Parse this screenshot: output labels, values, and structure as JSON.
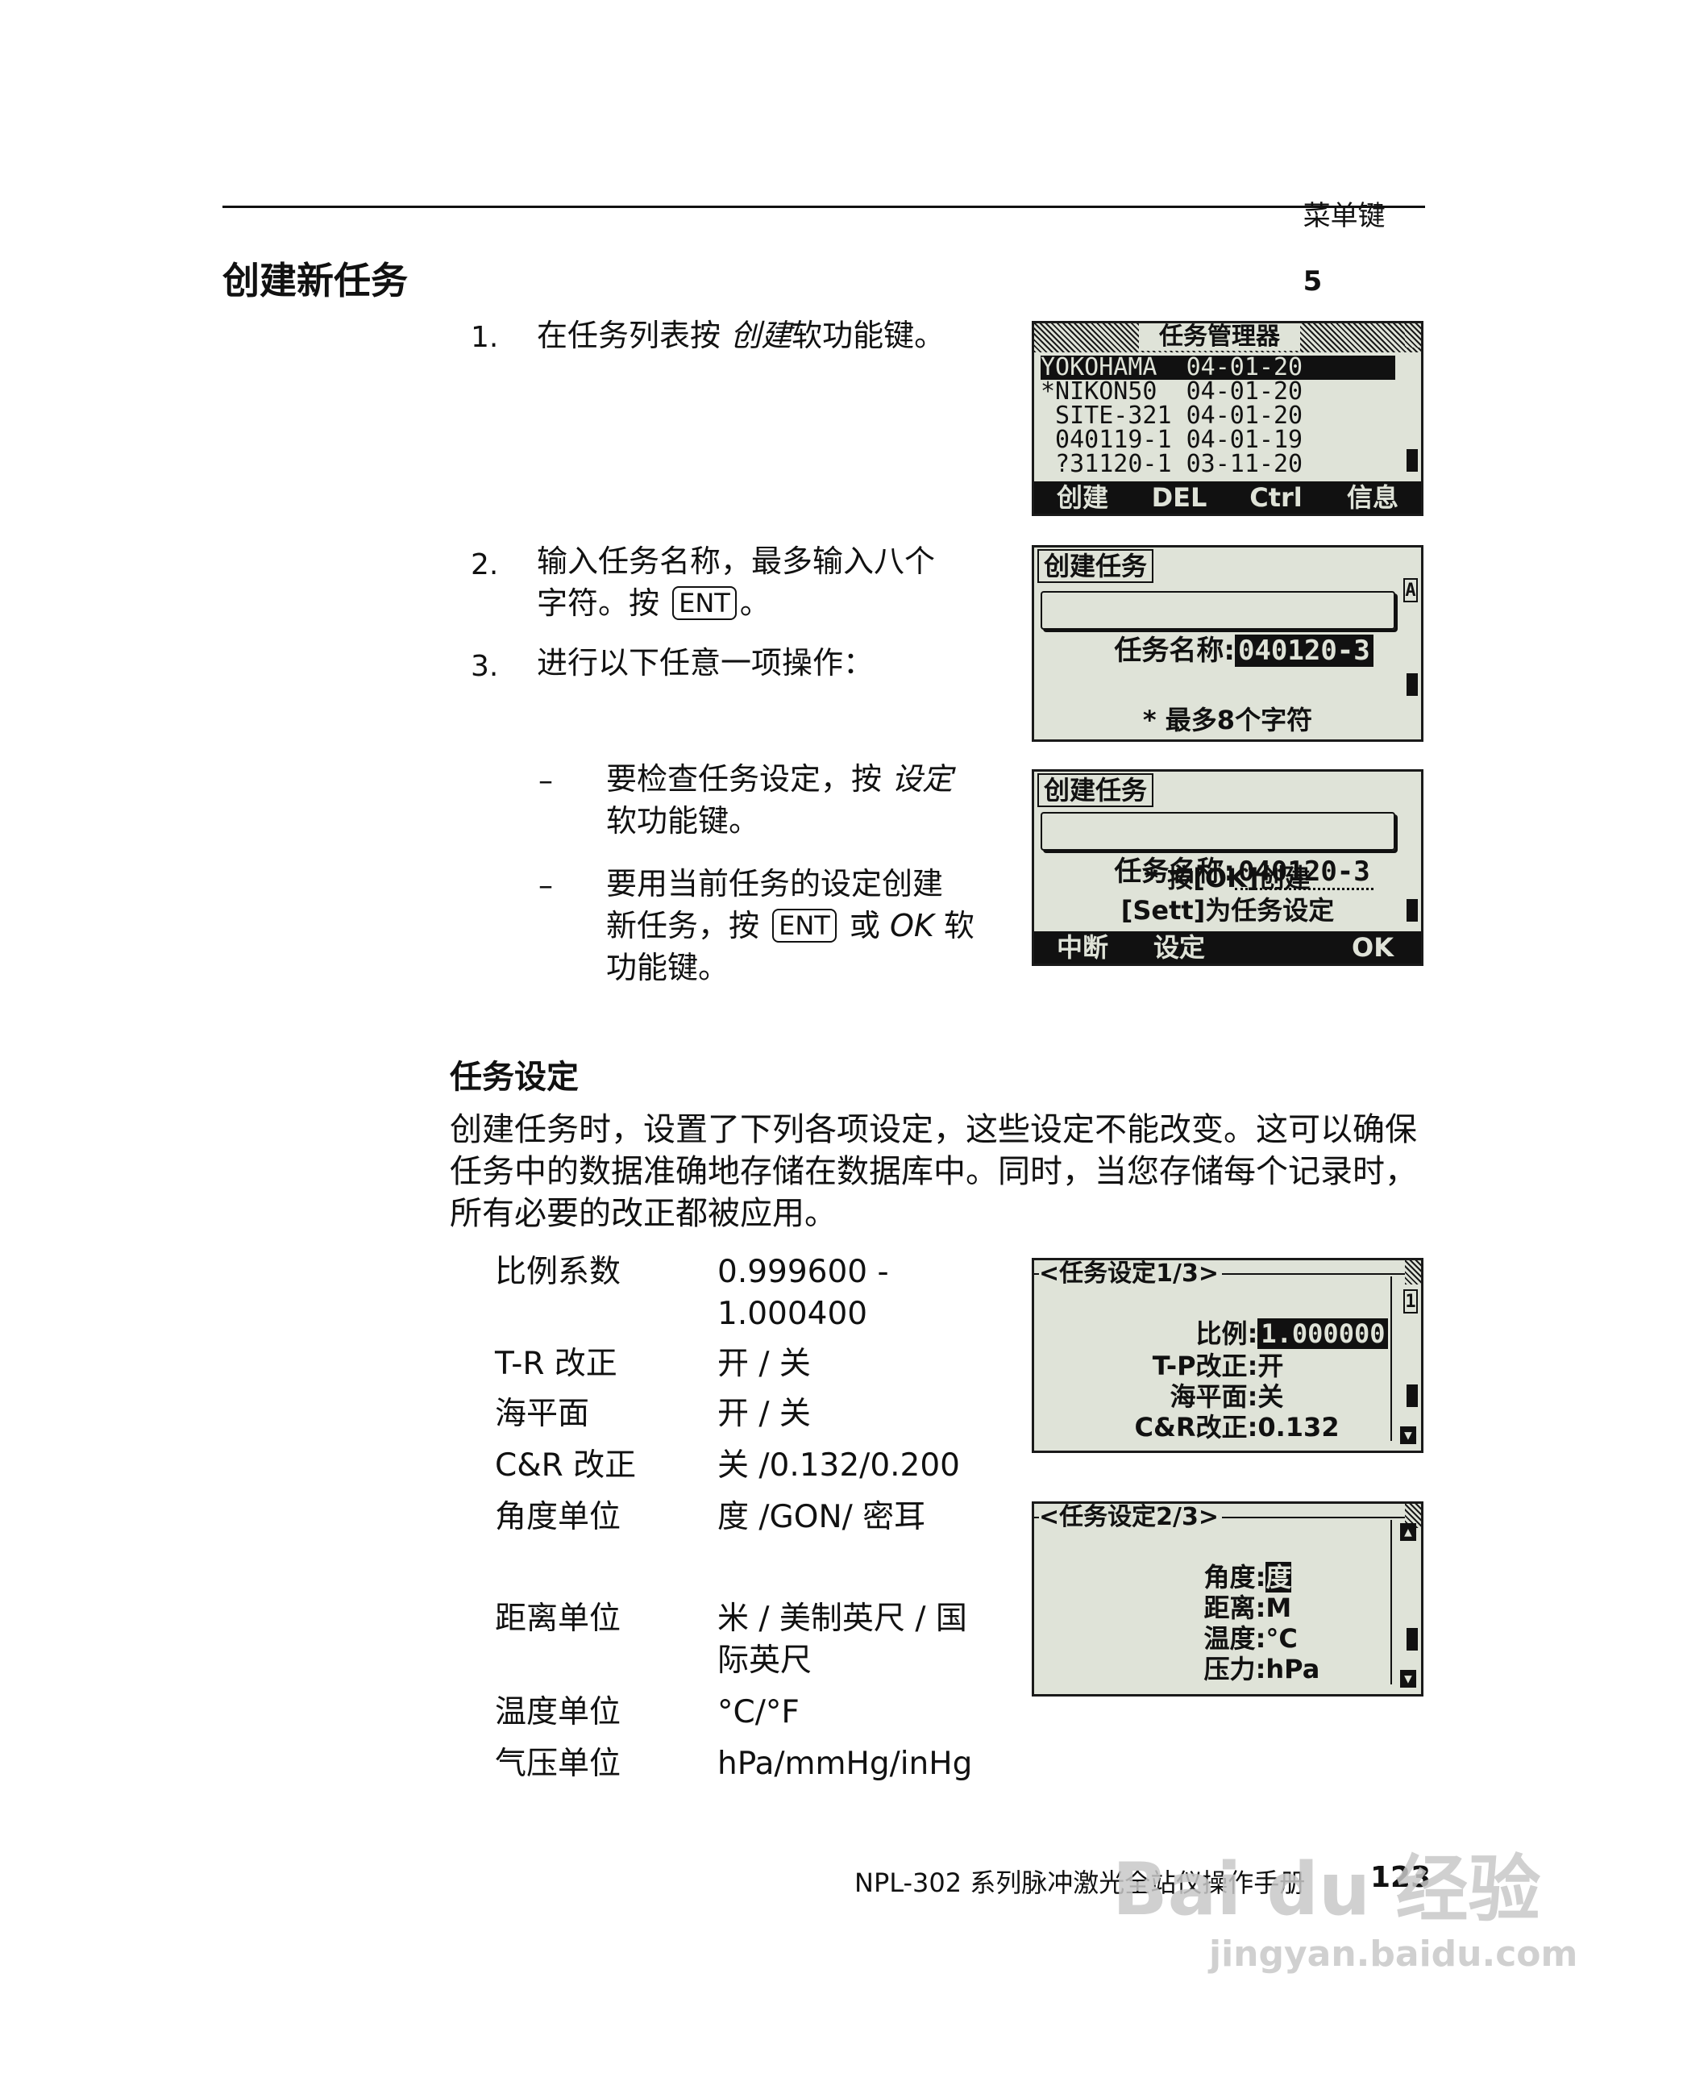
{
  "header": {
    "section_title": "菜单键",
    "chapter_number": "5"
  },
  "heading_main": "创建新任务",
  "steps": [
    {
      "num": "1.",
      "parts": [
        "在任务列表按 ",
        "创建",
        "软功能键。"
      ]
    },
    {
      "num": "2.",
      "line1": "输入任务名称，最多输入八个",
      "line2_pre": "字符。按 ",
      "key": "ENT",
      "line2_post": "。"
    },
    {
      "num": "3.",
      "text": "进行以下任意一项操作："
    }
  ],
  "sub_steps": [
    {
      "dash": "–",
      "line1_pre": "要检查任务设定，按 ",
      "line1_em": "设定",
      "line2": "软功能键。"
    },
    {
      "dash": "–",
      "line1": "要用当前任务的设定创建",
      "line2_pre": "新任务，按 ",
      "key": "ENT",
      "line2_mid": " 或 ",
      "line2_em": "OK",
      "line2_post": " 软",
      "line3": "功能键。"
    }
  ],
  "screen1": {
    "title": "任务管理器",
    "rows": [
      "YOKOHAMA  04-01-20",
      "*NIKON50  04-01-20",
      " SITE-321 04-01-20",
      " 040119-1 04-01-19",
      " ?31120-1 03-11-20"
    ],
    "softkeys": [
      "创建",
      "DEL",
      "Ctrl",
      "信息"
    ]
  },
  "screen2": {
    "tab": "创建任务",
    "field_label": "任务名称:",
    "field_value": "040120-3",
    "mode": "A",
    "hint": "* 最多8个字符"
  },
  "screen3": {
    "tab": "创建任务",
    "field_label": "任务名称:",
    "field_value": "040120-3",
    "msg1": "* 按[OK]创建",
    "msg2": "[Sett]为任务设定",
    "softkeys": [
      "中断",
      "设定",
      "",
      "OK"
    ]
  },
  "heading_sub": "任务设定",
  "paragraph": "创建任务时，设置了下列各项设定，这些设定不能改变。这可以确保任务中的数据准确地存储在数据库中。同时，当您存储每个记录时，所有必要的改正都被应用。",
  "specs": [
    {
      "label": "比例系数",
      "value1": "0.999600 -",
      "value2": "1.000400"
    },
    {
      "label": "T-R 改正",
      "value1": "开 / 关"
    },
    {
      "label": "海平面",
      "value1": "开 / 关"
    },
    {
      "label": "C&R 改正",
      "value1": "关 /0.132/0.200"
    },
    {
      "label": "角度单位",
      "value1": "度 /GON/ 密耳"
    },
    {
      "label": "距离单位",
      "value1": "米 / 美制英尺 / 国",
      "value2": "际英尺"
    },
    {
      "label": "温度单位",
      "value1": "°C/°F"
    },
    {
      "label": "气压单位",
      "value1": "hPa/mmHg/inHg"
    }
  ],
  "screen4": {
    "title": "<任务设定1/3>",
    "mode": "1",
    "rows": [
      {
        "label": "比例",
        "value": "1.000000"
      },
      {
        "label": "T-P改正",
        "value": "开"
      },
      {
        "label": "海平面",
        "value": "关"
      },
      {
        "label": "C&R改正",
        "value": "0.132"
      }
    ]
  },
  "screen5": {
    "title": "<任务设定2/3>",
    "rows": [
      {
        "label": "角度",
        "value": "度"
      },
      {
        "label": "距离",
        "value": "M"
      },
      {
        "label": "温度",
        "value": "°C"
      },
      {
        "label": "压力",
        "value": "hPa"
      }
    ]
  },
  "footer": {
    "manual_title": "NPL-302 系列脉冲激光全站仪操作手册",
    "page_number": "123"
  },
  "watermark": {
    "logo_text": "Bai du 经验",
    "url": "jingyan.baidu.com"
  }
}
